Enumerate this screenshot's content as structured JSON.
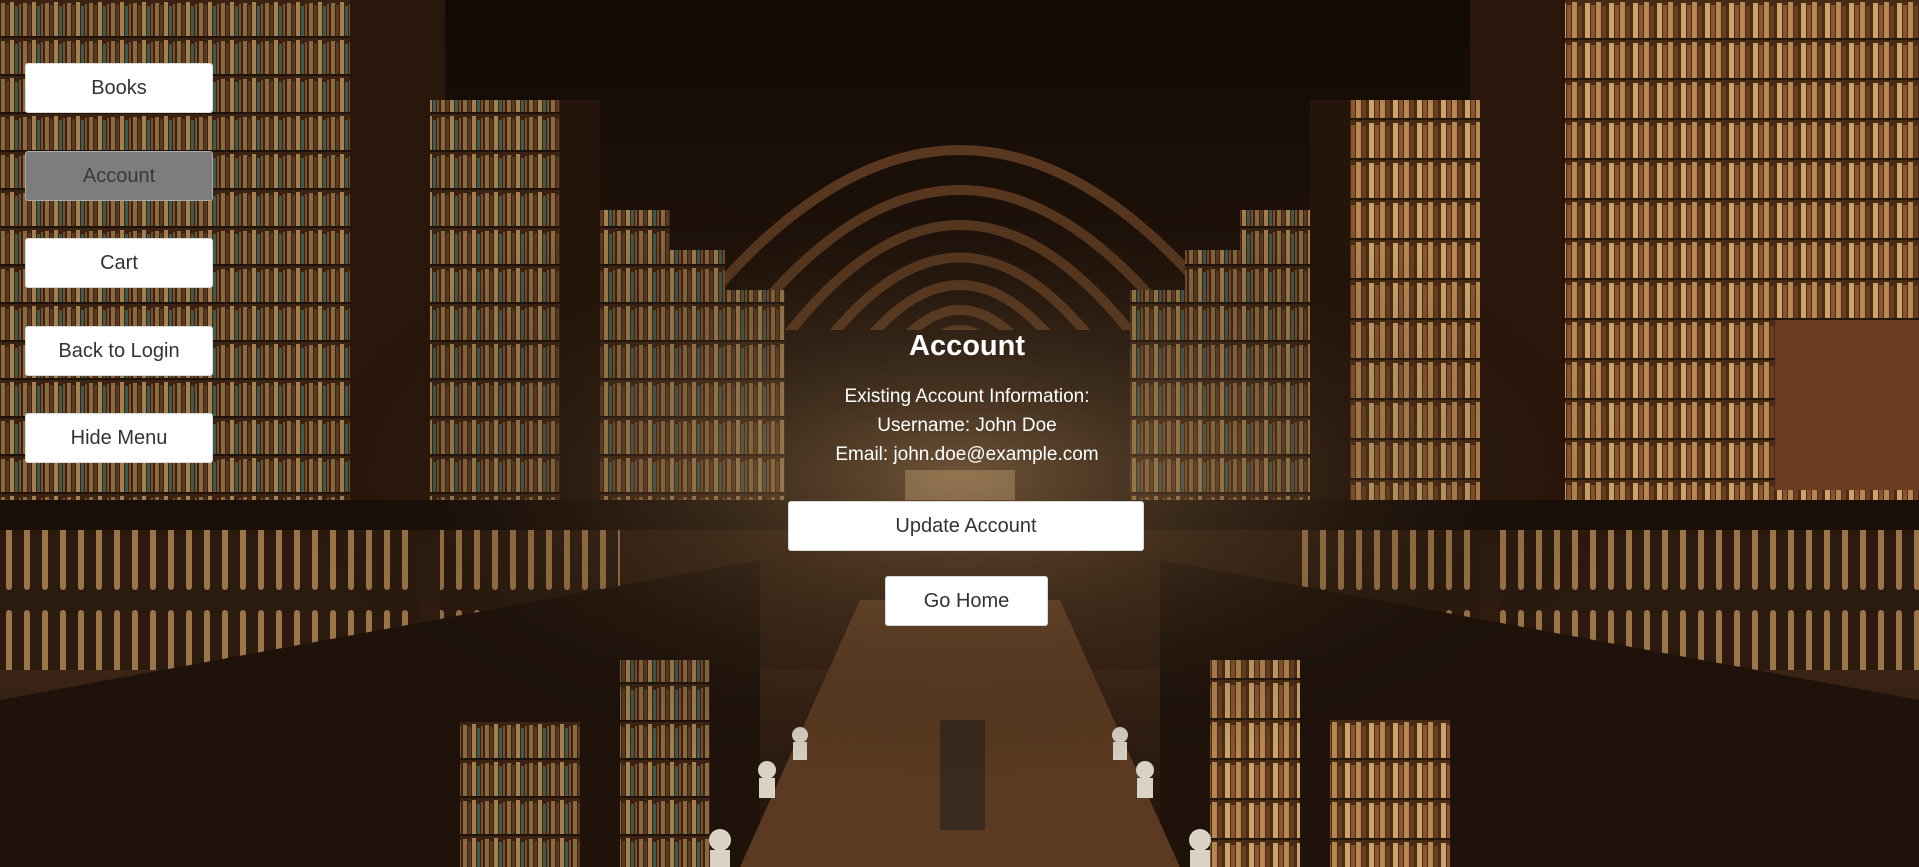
{
  "sidebar": {
    "items": [
      {
        "label": "Books"
      },
      {
        "label": "Account"
      },
      {
        "label": "Cart"
      },
      {
        "label": "Back to Login"
      },
      {
        "label": "Hide Menu"
      }
    ],
    "active_item": "Account"
  },
  "account": {
    "title": "Account",
    "info_heading": "Existing Account Information:",
    "username_line": "Username: John Doe",
    "email_line": "Email: john.doe@example.com",
    "update_label": "Update Account",
    "home_label": "Go Home"
  },
  "background": {
    "description_icon": "library-hall-image",
    "colors": {
      "wood_dark": "#1f130b",
      "wood_mid": "#4a2c18",
      "book_warm": "#8a5a30",
      "floor": "#6b4526"
    }
  }
}
